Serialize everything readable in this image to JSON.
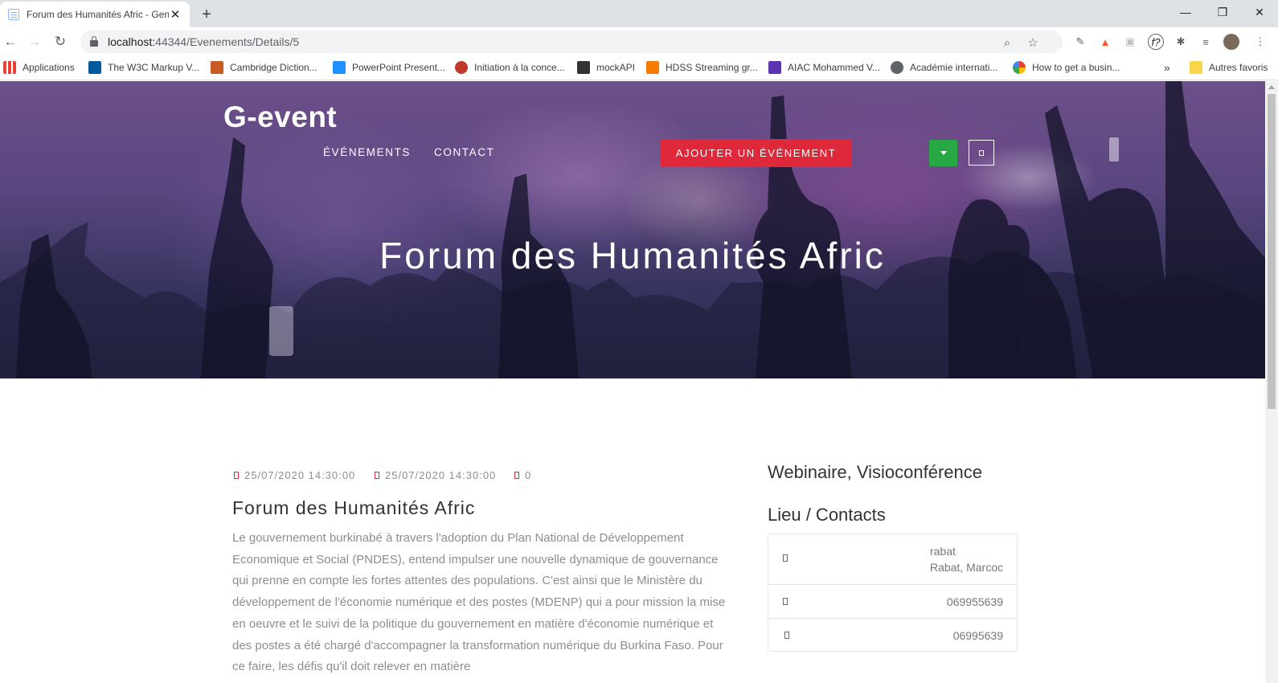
{
  "browser": {
    "tab_title": "Forum des Humanités Afric - Gen",
    "tab_close": "✕",
    "new_tab": "+",
    "url_host": "localhost:",
    "url_path": "44344/Evenements/Details/5",
    "window_controls": {
      "minimize": "—",
      "maximize": "❐",
      "close": "✕"
    },
    "bookmarks": [
      {
        "label": "Applications",
        "icon": "apps-grid-icon",
        "color": "#ea4335"
      },
      {
        "label": "The W3C Markup V...",
        "icon": "w3c-icon",
        "color": "#005a9c"
      },
      {
        "label": "Cambridge Diction...",
        "icon": "cambridge-icon",
        "color": "#c85a24"
      },
      {
        "label": "PowerPoint Present...",
        "icon": "powerpoint-icon",
        "color": "#1e90ff"
      },
      {
        "label": "Initiation à la conce...",
        "icon": "conception-icon",
        "color": "#c0392b"
      },
      {
        "label": "mockAPI",
        "icon": "mockapi-icon",
        "color": "#333333"
      },
      {
        "label": "HDSS Streaming gr...",
        "icon": "hdss-icon",
        "color": "#f57c00"
      },
      {
        "label": "AIAC Mohammed V...",
        "icon": "aiac-icon",
        "color": "#5e35b1"
      },
      {
        "label": "Académie internati...",
        "icon": "globe-icon",
        "color": "#5f6368"
      },
      {
        "label": "How to get a busin...",
        "icon": "google-icon",
        "color": "#4285f4"
      }
    ],
    "bookmarks_more": "»",
    "other_bookmarks": "Autres favoris"
  },
  "site": {
    "brand": "G-event",
    "nav": [
      "ÉVÉNEMENTS",
      "CONTACT"
    ],
    "add_event_label": "AJOUTER UN ÉVÉNEMENT",
    "hero_title": "Forum des Humanités Afric"
  },
  "event": {
    "start": "25/07/2020 14:30:00",
    "end": "25/07/2020 14:30:00",
    "count": "0",
    "title": "Forum des Humanités Afric",
    "description": "Le gouvernement burkinabé à travers l'adoption du Plan National de Développement Economique et Social (PNDES), entend impulser une nouvelle dynamique de gouvernance qui prenne en compte les fortes attentes des populations. C'est ainsi que le Ministère du développement de l'économie numérique et des postes (MDENP) qui a pour mission la mise en oeuvre et le suivi de la politique du gouvernement en matière d'économie numérique et des postes a été chargé d'accompagner la transformation numérique du Burkina Faso. Pour ce faire, les défis qu'il doit relever en matière"
  },
  "sidebar": {
    "category": "Webinaire, Visioconférence",
    "contacts_heading": "Lieu / Contacts",
    "address_line1": "rabat",
    "address_line2": "Rabat, Marcoc",
    "phone": "069955639",
    "mobile": "06995639"
  }
}
